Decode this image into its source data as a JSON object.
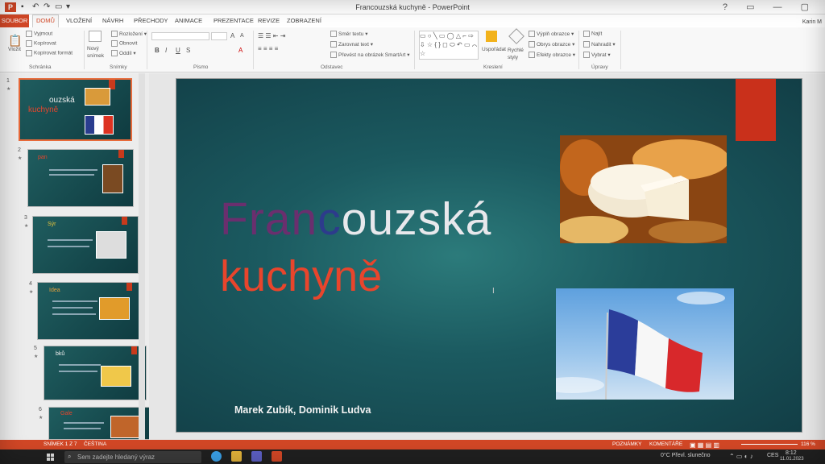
{
  "window": {
    "title": "Francouzská kuchyně - PowerPoint",
    "user": "Karin M"
  },
  "tabs": [
    "SOUBOR",
    "DOMŮ",
    "VLOŽENÍ",
    "NÁVRH",
    "PŘECHODY",
    "ANIMACE",
    "PREZENTACE",
    "REVIZE",
    "ZOBRAZENÍ"
  ],
  "ribbon": {
    "clipboard": {
      "paste": "Vložit",
      "cut": "Vyjmout",
      "copy": "Kopírovat",
      "format_painter": "Kopírovat formát",
      "group": "Schránka"
    },
    "slides": {
      "new_slide": "Nový snímek",
      "layout": "Rozložení",
      "reset": "Obnovit",
      "section": "Oddíl",
      "group": "Snímky"
    },
    "font": {
      "group": "Písmo"
    },
    "paragraph": {
      "text_direction": "Směr textu",
      "align_text": "Zarovnat text",
      "smartart": "Převést na obrázek SmartArt",
      "group": "Odstavec"
    },
    "drawing": {
      "arrange": "Uspořádat",
      "quick_styles": "Rychlé styly",
      "fill": "Výplň obrazce",
      "outline": "Obrys obrazce",
      "effects": "Efekty obrazce",
      "group": "Kreslení"
    },
    "editing": {
      "find": "Najít",
      "replace": "Nahradit",
      "select": "Vybrat",
      "group": "Úpravy"
    }
  },
  "thumbnails": [
    {
      "num": "1",
      "title": "ouzská",
      "title2": "kuchyně"
    },
    {
      "num": "2",
      "title": "pan"
    },
    {
      "num": "3",
      "title": "Sýr"
    },
    {
      "num": "4",
      "title": "Idea"
    },
    {
      "num": "5",
      "title": "bků"
    },
    {
      "num": "6",
      "title": "Gale"
    }
  ],
  "slide": {
    "title_part1": "Fran",
    "title_part2": "c",
    "title_part3": "ouzská",
    "subtitle": "kuchyně",
    "authors": "Marek Zubík, Dominik Ludva"
  },
  "status": {
    "slide_counter": "SNÍMEK 1 Z 7",
    "language": "ČEŠTINA",
    "notes": "POZNÁMKY",
    "comments": "KOMENTÁŘE",
    "zoom": "116 %"
  },
  "taskbar": {
    "search_placeholder": "Sem zadejte hledaný výraz",
    "weather": "0°C  Převl. slunečno",
    "lang": "CES",
    "time": "8:12",
    "date": "11.01.2023"
  },
  "colors": {
    "accent": "#d24726",
    "slide_red": "#c9301b",
    "title_orange": "#e8452c"
  }
}
